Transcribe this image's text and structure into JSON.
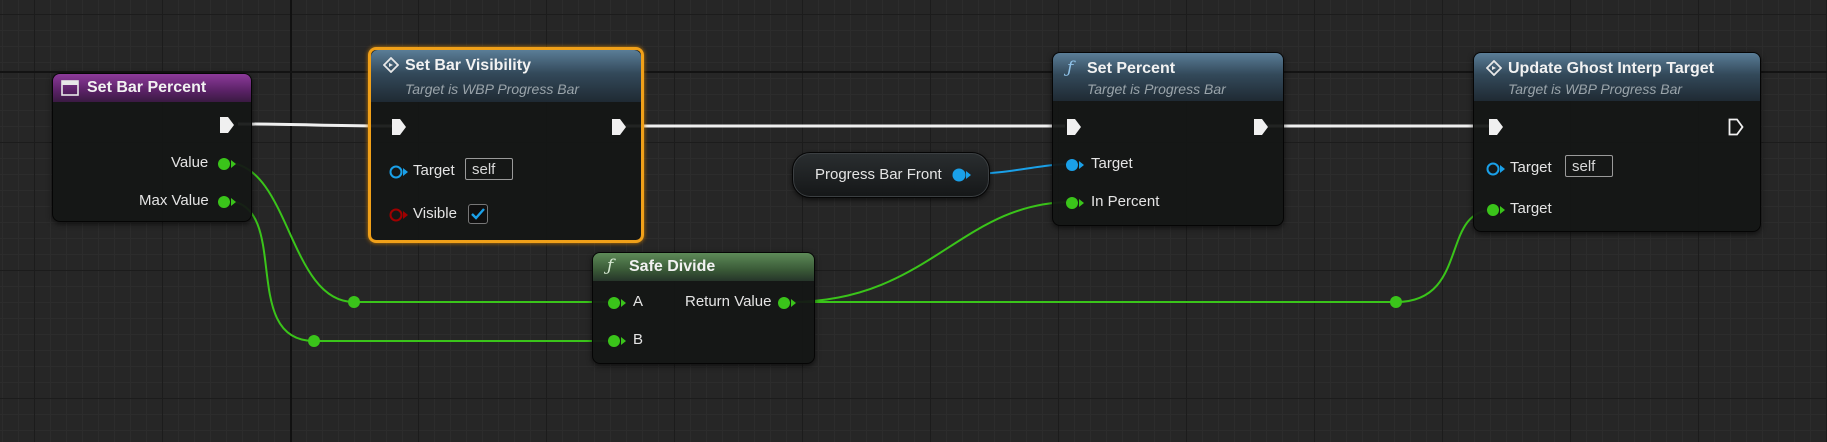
{
  "graph": {
    "nodes": {
      "set_bar_percent": {
        "title": "Set Bar Percent",
        "outputs": [
          "Value",
          "Max Value"
        ]
      },
      "set_bar_visibility": {
        "title": "Set Bar Visibility",
        "subtitle": "Target is WBP Progress Bar",
        "target_label": "Target",
        "target_value": "self",
        "visible_label": "Visible",
        "visible_checked": true
      },
      "progress_bar_front": {
        "label": "Progress Bar Front"
      },
      "set_percent": {
        "title": "Set Percent",
        "subtitle": "Target is Progress Bar",
        "inputs": [
          "Target",
          "In Percent"
        ]
      },
      "update_ghost": {
        "title": "Update Ghost Interp Target",
        "subtitle": "Target is WBP Progress Bar",
        "target_label": "Target",
        "target_value": "self",
        "target2_label": "Target"
      },
      "safe_divide": {
        "title": "Safe Divide",
        "inputs": [
          "A",
          "B"
        ],
        "output": "Return Value"
      }
    },
    "colors": {
      "float_pin": "#3ac41a",
      "object_pin": "#1aa0e8",
      "bool_pin": "#a00000",
      "exec_wire": "#f0f0f0",
      "selection": "#f0a019"
    },
    "icons": {
      "event": "event-icon",
      "function": "function-icon",
      "interface_call": "interface-call-icon"
    }
  }
}
